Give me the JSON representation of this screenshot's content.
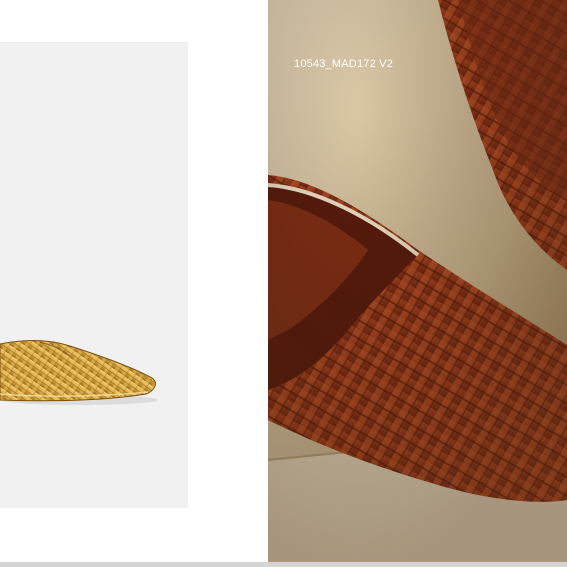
{
  "photo": {
    "caption": "10543_MAD172 V2"
  },
  "product": {
    "image_name": "gold-woven-leather-mule",
    "accent_color": "#d8a63e"
  },
  "lifestyle": {
    "image_name": "brown-woven-leather-mule-photo",
    "accent_color": "#9a3a1a"
  }
}
